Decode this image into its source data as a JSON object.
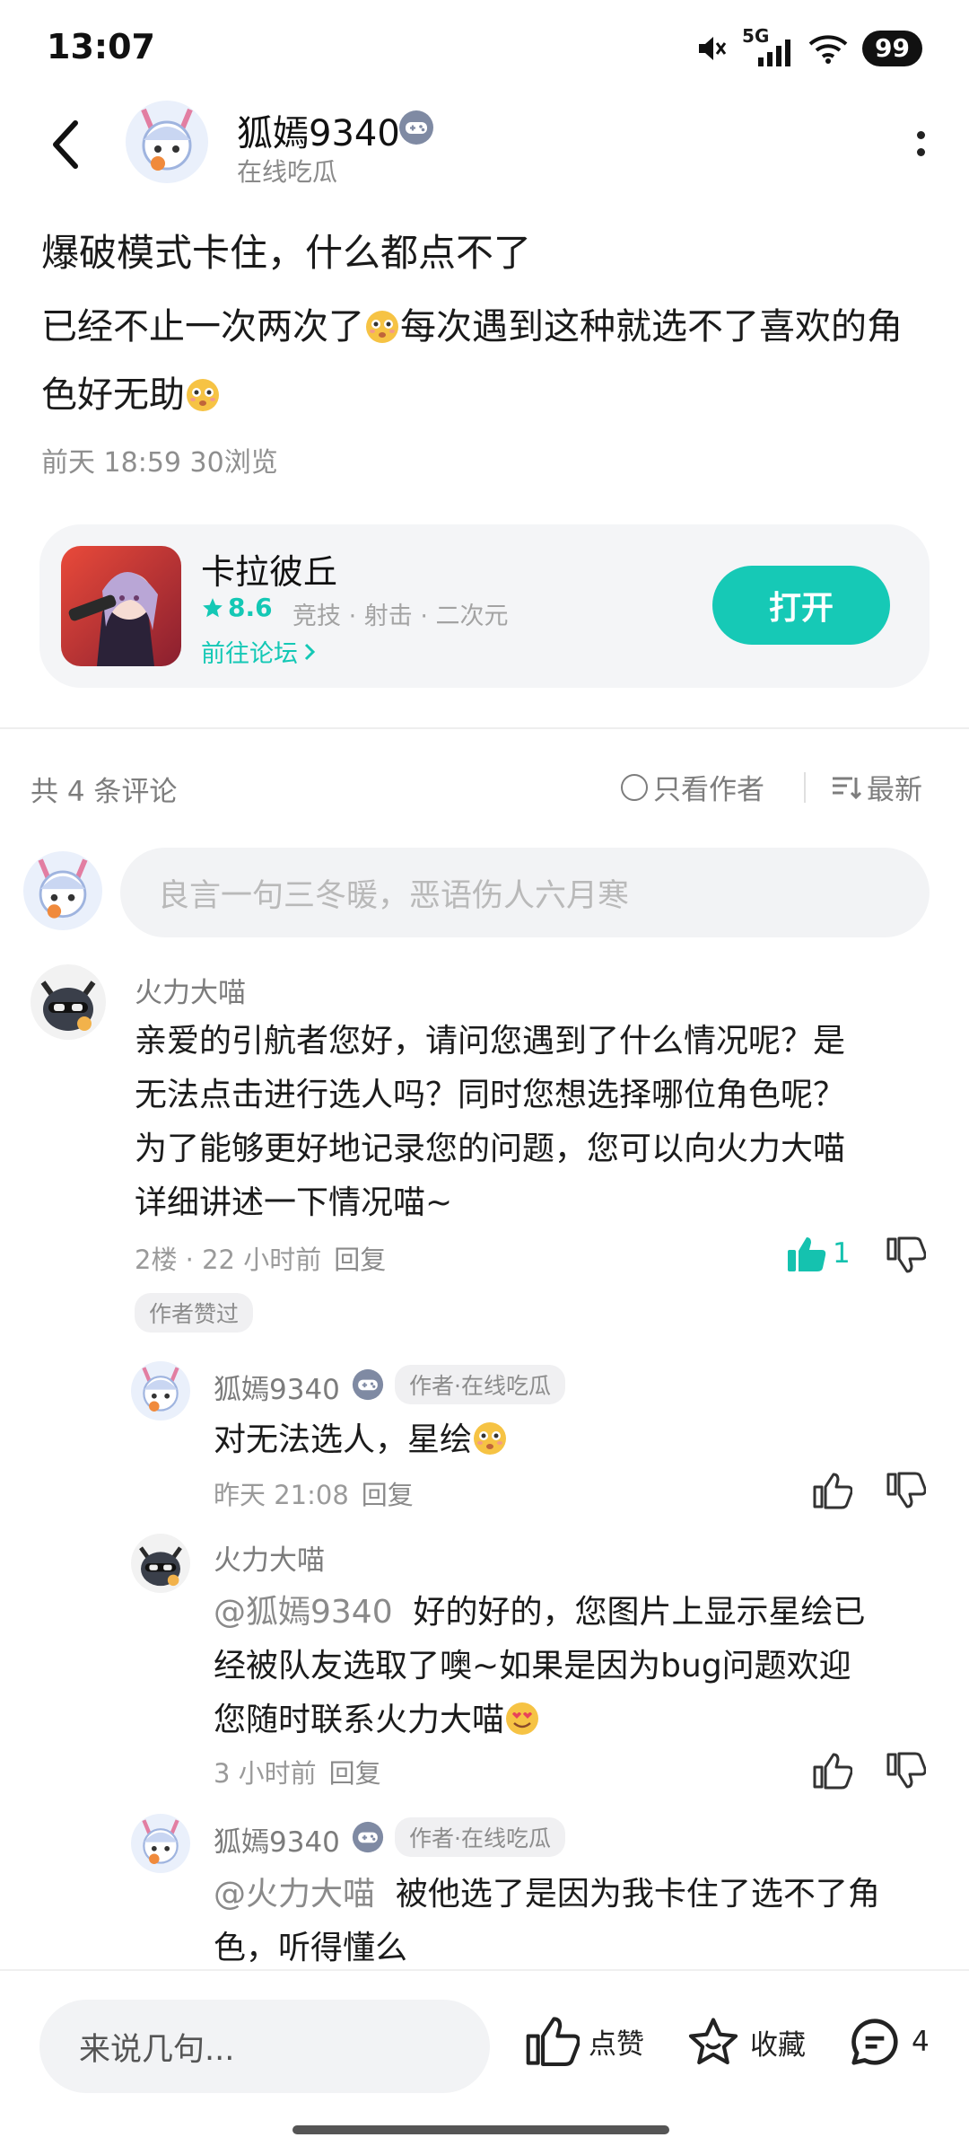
{
  "status_bar": {
    "time": "13:07",
    "network": "5G",
    "battery": "99"
  },
  "header": {
    "author_name": "狐嫣9340",
    "author_status": "在线吃瓜"
  },
  "post": {
    "title": "爆破模式卡住，什么都点不了",
    "body_line1": "已经不止一次两次了",
    "body_line1b": "每次遇到这种就选不了喜欢的角",
    "body_line2": "色好无助",
    "meta": "前天 18:59  30浏览"
  },
  "game_card": {
    "name": "卡拉彼丘",
    "rating": "8.6",
    "tags": "竞技 · 射击 · 二次元",
    "forum_link": "前往论坛",
    "open_button": "打开"
  },
  "comments_bar": {
    "count": "共 4 条评论",
    "only_author": "只看作者",
    "sort": "最新"
  },
  "composer": {
    "placeholder": "良言一句三冬暖，恶语伤人六月寒"
  },
  "comments": [
    {
      "name": "火力大喵",
      "text1": "亲爱的引航者您好，请问您遇到了什么情况呢？是",
      "text2": "无法点击进行选人吗？同时您想选择哪位角色呢？",
      "text3": "为了能够更好地记录您的问题，您可以向火力大喵",
      "text4": "详细讲述一下情况喵~",
      "floor_time": "2楼 · 22 小时前",
      "reply": "回复",
      "like_count": "1",
      "author_liked": "作者赞过"
    },
    {
      "name": "狐嫣9340",
      "tag": "作者·在线吃瓜",
      "text": "对无法选人，星绘",
      "time": "昨天 21:08",
      "reply": "回复"
    },
    {
      "name": "火力大喵",
      "mention": "@狐嫣9340",
      "text1": "好的好的，您图片上显示星绘已",
      "text2": "经被队友选取了噢~如果是因为bug问题欢迎",
      "text3": "您随时联系火力大喵",
      "time": "3 小时前",
      "reply": "回复"
    },
    {
      "name": "狐嫣9340",
      "tag": "作者·在线吃瓜",
      "mention": "@火力大喵",
      "text1": "被他选了是因为我卡住了选不了角",
      "text2": "色，听得懂么"
    }
  ],
  "bottom_bar": {
    "placeholder": "来说几句...",
    "like": "点赞",
    "favorite": "收藏",
    "comment_count": "4"
  },
  "colors": {
    "accent": "#16c9b6",
    "badge": "#7f8aa3"
  }
}
